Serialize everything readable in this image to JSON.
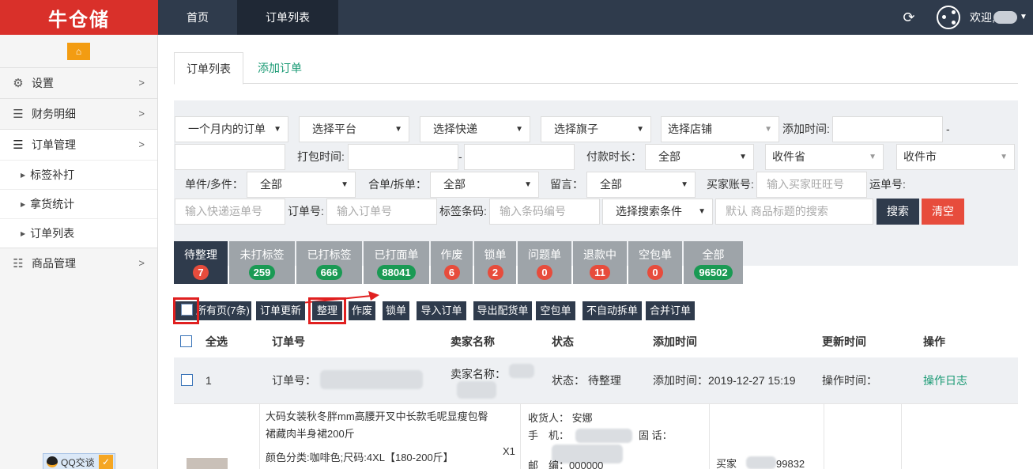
{
  "app": {
    "logo_text": "牛仓储",
    "nav": [
      "首页",
      "订单列表"
    ],
    "welcome": "欢迎,"
  },
  "sidebar": {
    "items": [
      {
        "label": "设置",
        "icon": "gears-icon"
      },
      {
        "label": "财务明细",
        "icon": "list-icon"
      },
      {
        "label": "订单管理",
        "icon": "list-icon"
      },
      {
        "label": "商品管理",
        "icon": "list-icon"
      }
    ],
    "sub_items": [
      "标签补打",
      "拿货统计",
      "订单列表"
    ],
    "qq_label": "QQ交谈"
  },
  "tabs": {
    "active": "订单列表",
    "add": "添加订单"
  },
  "filter": {
    "time_range": "一个月内的订单",
    "platform": "选择平台",
    "express": "选择快递",
    "flag": "选择旗子",
    "shop": "选择店铺",
    "add_time_label": "添加时间:",
    "dash": "-",
    "pack_time_label": "打包时间:",
    "pay_duration_label": "付款时长：",
    "pay_duration_value": "全部",
    "province": "收件省",
    "city": "收件市",
    "single_multi_label": "单件/多件：",
    "single_multi_value": "全部",
    "merge_split_label": "合单/拆单：",
    "merge_split_value": "全部",
    "message_label": "留言：",
    "message_value": "全部",
    "buyer_label": "买家账号:",
    "buyer_placeholder": "输入买家旺旺号",
    "waybill_label": "运单号:",
    "waybill_placeholder": "输入快递运单号",
    "order_no_label": "订单号:",
    "order_no_placeholder": "输入订单号",
    "barcode_label": "标签条码:",
    "barcode_placeholder": "输入条码编号",
    "search_condition": "选择搜索条件",
    "keyword_placeholder": "默认 商品标题的搜索",
    "search_btn": "搜索",
    "clear_btn": "清空"
  },
  "status_tiles": [
    {
      "label": "待整理",
      "count": "7",
      "color": "red"
    },
    {
      "label": "未打标签",
      "count": "259",
      "color": "green"
    },
    {
      "label": "已打标签",
      "count": "666",
      "color": "green"
    },
    {
      "label": "已打面单",
      "count": "88041",
      "color": "green"
    },
    {
      "label": "作废",
      "count": "6",
      "color": "red"
    },
    {
      "label": "锁单",
      "count": "2",
      "color": "red"
    },
    {
      "label": "问题单",
      "count": "0",
      "color": "red"
    },
    {
      "label": "退款中",
      "count": "11",
      "color": "red"
    },
    {
      "label": "空包单",
      "count": "0",
      "color": "red"
    },
    {
      "label": "全部",
      "count": "96502",
      "color": "green"
    }
  ],
  "actions": {
    "all_pages": "所有页(7条)",
    "buttons": [
      "订单更新",
      "整理",
      "作废",
      "锁单",
      "导入订单",
      "导出配货单",
      "空包单",
      "不自动拆单",
      "合并订单"
    ]
  },
  "table": {
    "headers": [
      "全选",
      "订单号",
      "卖家名称",
      "状态",
      "添加时间",
      "更新时间",
      "操作"
    ],
    "row": {
      "index": "1",
      "order_label": "订单号：",
      "seller_label": "卖家名称：",
      "status": "状态： 待整理",
      "add_time": "添加时间：2019-12-27 15:19",
      "op_time": "操作时间：",
      "op_log": "操作日志"
    },
    "detail": {
      "product_line1": "大码女装秋冬胖mm高腰开叉中长款毛呢显瘦包臀",
      "product_line2": "裙藏肉半身裙200斤",
      "sku": "颜色分类:咖啡色;尺码:4XL【180-200斤】",
      "qty": "X1",
      "receiver": "收货人： 安娜",
      "mobile": "手　机：",
      "tel": "固 话：",
      "postcode": "邮　编：000000",
      "buyer": "买家",
      "buyer_tail": "99832"
    }
  },
  "colors": {
    "topbar": "#2f3b4c",
    "logo_bg": "#d9302a",
    "accent_green": "#1a9a74",
    "danger": "#e74c3c"
  }
}
